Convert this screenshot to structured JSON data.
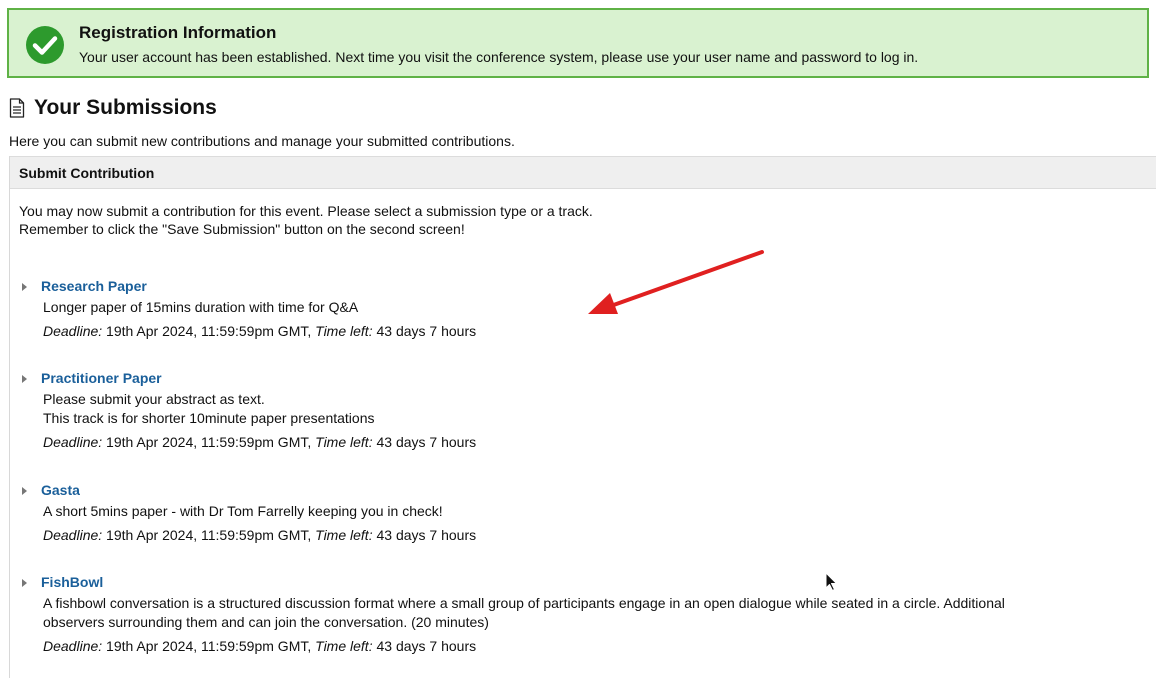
{
  "banner": {
    "title": "Registration Information",
    "message": "Your user account has been established. Next time you visit the conference system, please use your user name and password to log in.",
    "icon": "check-circle-icon",
    "color": "#2d9a2d"
  },
  "submissions": {
    "heading": "Your Submissions",
    "icon": "document-icon",
    "intro": "Here you can submit new contributions and manage your submitted contributions."
  },
  "panel": {
    "header": "Submit Contribution",
    "intro_line1": "You may now submit a contribution for this event. Please select a submission type or a track.",
    "intro_line2": "Remember to click the \"Save Submission\" button on the second screen!"
  },
  "labels": {
    "deadline": "Deadline:",
    "time_left": "Time left:"
  },
  "tracks": [
    {
      "name": "Research Paper",
      "desc1": "Longer paper of 15mins duration with time for Q&A",
      "deadline": "19th Apr 2024, 11:59:59pm GMT,",
      "time_left": "43 days 7 hours"
    },
    {
      "name": "Practitioner Paper",
      "desc1": "Please submit your abstract as text.",
      "desc2": "This track is for shorter 10minute paper presentations",
      "deadline": "19th Apr 2024, 11:59:59pm GMT,",
      "time_left": "43 days 7 hours"
    },
    {
      "name": "Gasta",
      "desc1": "A short 5mins paper - with Dr Tom Farrelly keeping you in check!",
      "deadline": "19th Apr 2024, 11:59:59pm GMT,",
      "time_left": "43 days 7 hours"
    },
    {
      "name": "FishBowl",
      "desc1": "A fishbowl conversation is a structured discussion format where a small group of participants engage in an open dialogue while seated in a circle. Additional",
      "desc2": "observers surrounding them and can join the conversation. (20 minutes)",
      "deadline": "19th Apr 2024, 11:59:59pm GMT,",
      "time_left": "43 days 7 hours"
    }
  ],
  "colors": {
    "link": "#1a5f9a",
    "banner_bg": "#d9f2d0",
    "banner_border": "#5fb246",
    "annotation_arrow": "#e02020"
  }
}
